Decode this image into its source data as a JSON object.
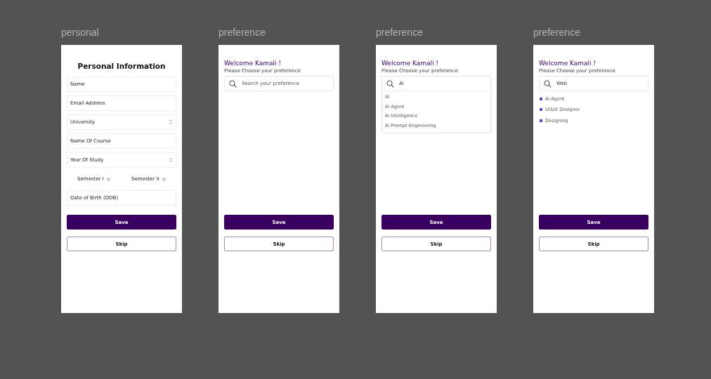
{
  "frames": [
    {
      "label": "personal",
      "kind": "personal",
      "title": "Personal Information",
      "fields": [
        {
          "kind": "text",
          "placeholder": "Name"
        },
        {
          "kind": "text",
          "placeholder": "Email Address"
        },
        {
          "kind": "select",
          "placeholder": "University"
        },
        {
          "kind": "text",
          "placeholder": "Name Of Course"
        },
        {
          "kind": "select",
          "placeholder": "Year Of Study"
        },
        {
          "kind": "radios",
          "options": [
            {
              "label": "Semester I",
              "selected": false
            },
            {
              "label": "Semester II",
              "selected": false
            }
          ]
        },
        {
          "kind": "text",
          "placeholder": "Date of Birth (DOB)"
        }
      ],
      "buttons": [
        {
          "kind": "primary",
          "label": "Save"
        },
        {
          "kind": "secondary",
          "label": "Skip"
        }
      ]
    },
    {
      "label": "preference",
      "kind": "preference",
      "greeting": "Welcome Kamali !",
      "subtitle": "Please Choose your preference",
      "search": {
        "placeholder": "Search your preference"
      },
      "buttons": [
        {
          "kind": "primary",
          "label": "Save"
        },
        {
          "kind": "secondary",
          "label": "Skip"
        }
      ]
    },
    {
      "label": "preference",
      "kind": "preference",
      "greeting": "Welcome Kamali !",
      "subtitle": "Please Choose your preference",
      "search": {
        "value": "Ai"
      },
      "suggestions": [
        "AI",
        "Ai Agent",
        "Ai Intelligence",
        "Ai Prompt Engineering"
      ],
      "buttons": [
        {
          "kind": "primary",
          "label": "Save"
        },
        {
          "kind": "secondary",
          "label": "Skip"
        }
      ]
    },
    {
      "label": "preference",
      "kind": "preference",
      "greeting": "Welcome Kamali !",
      "subtitle": "Please Choose your preference",
      "search": {
        "value": "Web"
      },
      "chosen": [
        "Ai Agent",
        "UI/UX Designer",
        "Designing"
      ],
      "buttons": [
        {
          "kind": "primary",
          "label": "Save"
        },
        {
          "kind": "secondary",
          "label": "Skip"
        }
      ]
    }
  ]
}
